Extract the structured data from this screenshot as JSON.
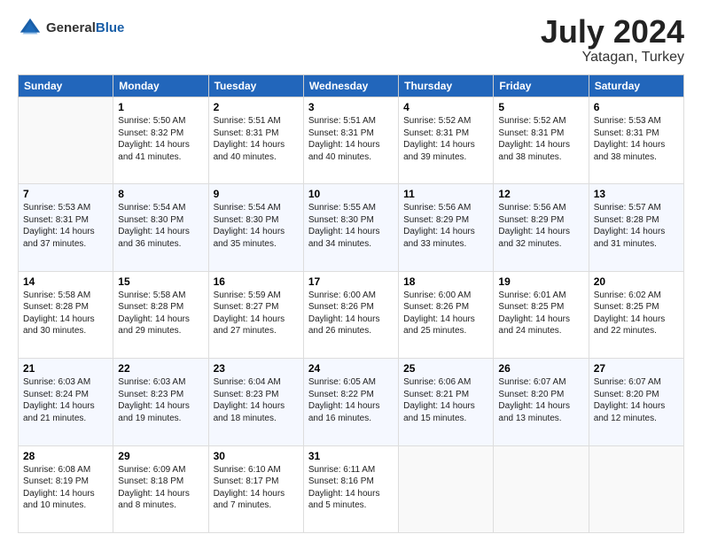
{
  "header": {
    "logo_line1": "General",
    "logo_line2": "Blue",
    "month": "July 2024",
    "location": "Yatagan, Turkey"
  },
  "days_of_week": [
    "Sunday",
    "Monday",
    "Tuesday",
    "Wednesday",
    "Thursday",
    "Friday",
    "Saturday"
  ],
  "weeks": [
    [
      {
        "day": "",
        "info": ""
      },
      {
        "day": "1",
        "info": "Sunrise: 5:50 AM\nSunset: 8:32 PM\nDaylight: 14 hours\nand 41 minutes."
      },
      {
        "day": "2",
        "info": "Sunrise: 5:51 AM\nSunset: 8:31 PM\nDaylight: 14 hours\nand 40 minutes."
      },
      {
        "day": "3",
        "info": "Sunrise: 5:51 AM\nSunset: 8:31 PM\nDaylight: 14 hours\nand 40 minutes."
      },
      {
        "day": "4",
        "info": "Sunrise: 5:52 AM\nSunset: 8:31 PM\nDaylight: 14 hours\nand 39 minutes."
      },
      {
        "day": "5",
        "info": "Sunrise: 5:52 AM\nSunset: 8:31 PM\nDaylight: 14 hours\nand 38 minutes."
      },
      {
        "day": "6",
        "info": "Sunrise: 5:53 AM\nSunset: 8:31 PM\nDaylight: 14 hours\nand 38 minutes."
      }
    ],
    [
      {
        "day": "7",
        "info": "Sunrise: 5:53 AM\nSunset: 8:31 PM\nDaylight: 14 hours\nand 37 minutes."
      },
      {
        "day": "8",
        "info": "Sunrise: 5:54 AM\nSunset: 8:30 PM\nDaylight: 14 hours\nand 36 minutes."
      },
      {
        "day": "9",
        "info": "Sunrise: 5:54 AM\nSunset: 8:30 PM\nDaylight: 14 hours\nand 35 minutes."
      },
      {
        "day": "10",
        "info": "Sunrise: 5:55 AM\nSunset: 8:30 PM\nDaylight: 14 hours\nand 34 minutes."
      },
      {
        "day": "11",
        "info": "Sunrise: 5:56 AM\nSunset: 8:29 PM\nDaylight: 14 hours\nand 33 minutes."
      },
      {
        "day": "12",
        "info": "Sunrise: 5:56 AM\nSunset: 8:29 PM\nDaylight: 14 hours\nand 32 minutes."
      },
      {
        "day": "13",
        "info": "Sunrise: 5:57 AM\nSunset: 8:28 PM\nDaylight: 14 hours\nand 31 minutes."
      }
    ],
    [
      {
        "day": "14",
        "info": "Sunrise: 5:58 AM\nSunset: 8:28 PM\nDaylight: 14 hours\nand 30 minutes."
      },
      {
        "day": "15",
        "info": "Sunrise: 5:58 AM\nSunset: 8:28 PM\nDaylight: 14 hours\nand 29 minutes."
      },
      {
        "day": "16",
        "info": "Sunrise: 5:59 AM\nSunset: 8:27 PM\nDaylight: 14 hours\nand 27 minutes."
      },
      {
        "day": "17",
        "info": "Sunrise: 6:00 AM\nSunset: 8:26 PM\nDaylight: 14 hours\nand 26 minutes."
      },
      {
        "day": "18",
        "info": "Sunrise: 6:00 AM\nSunset: 8:26 PM\nDaylight: 14 hours\nand 25 minutes."
      },
      {
        "day": "19",
        "info": "Sunrise: 6:01 AM\nSunset: 8:25 PM\nDaylight: 14 hours\nand 24 minutes."
      },
      {
        "day": "20",
        "info": "Sunrise: 6:02 AM\nSunset: 8:25 PM\nDaylight: 14 hours\nand 22 minutes."
      }
    ],
    [
      {
        "day": "21",
        "info": "Sunrise: 6:03 AM\nSunset: 8:24 PM\nDaylight: 14 hours\nand 21 minutes."
      },
      {
        "day": "22",
        "info": "Sunrise: 6:03 AM\nSunset: 8:23 PM\nDaylight: 14 hours\nand 19 minutes."
      },
      {
        "day": "23",
        "info": "Sunrise: 6:04 AM\nSunset: 8:23 PM\nDaylight: 14 hours\nand 18 minutes."
      },
      {
        "day": "24",
        "info": "Sunrise: 6:05 AM\nSunset: 8:22 PM\nDaylight: 14 hours\nand 16 minutes."
      },
      {
        "day": "25",
        "info": "Sunrise: 6:06 AM\nSunset: 8:21 PM\nDaylight: 14 hours\nand 15 minutes."
      },
      {
        "day": "26",
        "info": "Sunrise: 6:07 AM\nSunset: 8:20 PM\nDaylight: 14 hours\nand 13 minutes."
      },
      {
        "day": "27",
        "info": "Sunrise: 6:07 AM\nSunset: 8:20 PM\nDaylight: 14 hours\nand 12 minutes."
      }
    ],
    [
      {
        "day": "28",
        "info": "Sunrise: 6:08 AM\nSunset: 8:19 PM\nDaylight: 14 hours\nand 10 minutes."
      },
      {
        "day": "29",
        "info": "Sunrise: 6:09 AM\nSunset: 8:18 PM\nDaylight: 14 hours\nand 8 minutes."
      },
      {
        "day": "30",
        "info": "Sunrise: 6:10 AM\nSunset: 8:17 PM\nDaylight: 14 hours\nand 7 minutes."
      },
      {
        "day": "31",
        "info": "Sunrise: 6:11 AM\nSunset: 8:16 PM\nDaylight: 14 hours\nand 5 minutes."
      },
      {
        "day": "",
        "info": ""
      },
      {
        "day": "",
        "info": ""
      },
      {
        "day": "",
        "info": ""
      }
    ]
  ]
}
